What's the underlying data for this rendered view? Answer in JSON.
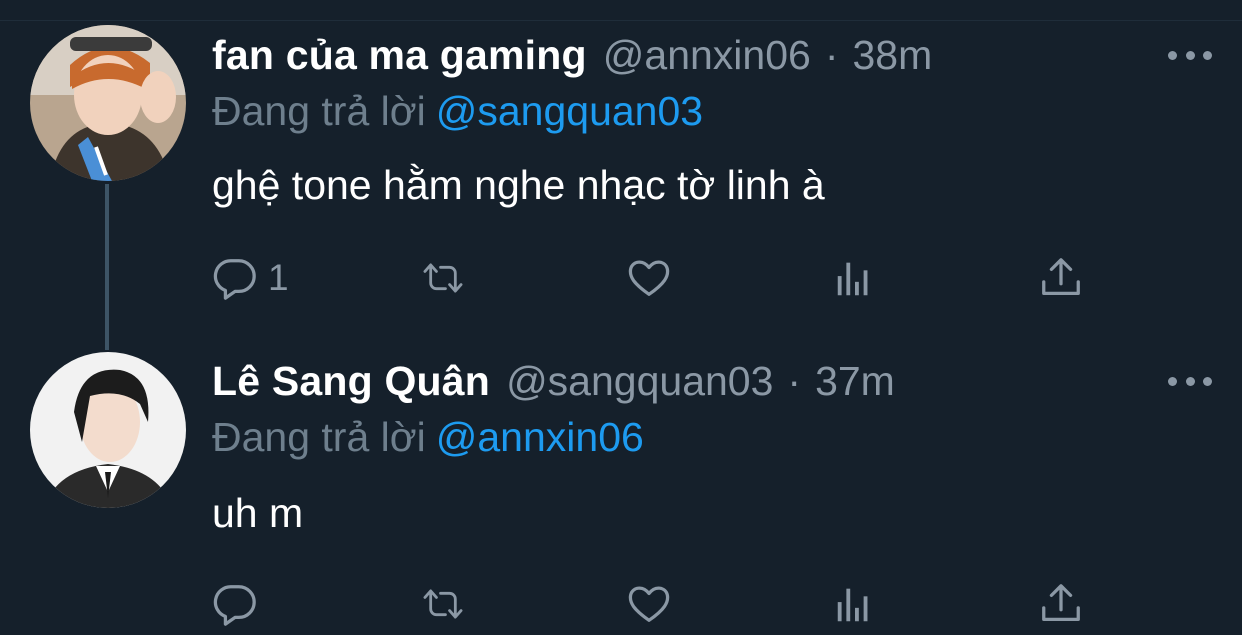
{
  "tweets": [
    {
      "display_name": "fan của ma gaming",
      "handle": "@annxin06",
      "separator": "·",
      "time": "38m",
      "reply_prefix": "Đang trả lời",
      "reply_to": "@sangquan03",
      "text": "ghệ tone hằm nghe nhạc tờ linh à",
      "reply_count": "1"
    },
    {
      "display_name": "Lê Sang Quân",
      "handle": "@sangquan03",
      "separator": "·",
      "time": "37m",
      "reply_prefix": "Đang trả lời",
      "reply_to": "@annxin06",
      "text": "uh m",
      "reply_count": ""
    }
  ],
  "icons": {
    "reply": "reply-icon",
    "retweet": "retweet-icon",
    "like": "heart-icon",
    "stats": "analytics-icon",
    "share": "share-icon",
    "more": "more-options-icon"
  },
  "colors": {
    "background": "#15202b",
    "primary_text": "#ffffff",
    "secondary_text": "#8b98a5",
    "mention": "#1d9bf0",
    "icon": "#8b98a5",
    "thread_line": "#3d5466"
  }
}
